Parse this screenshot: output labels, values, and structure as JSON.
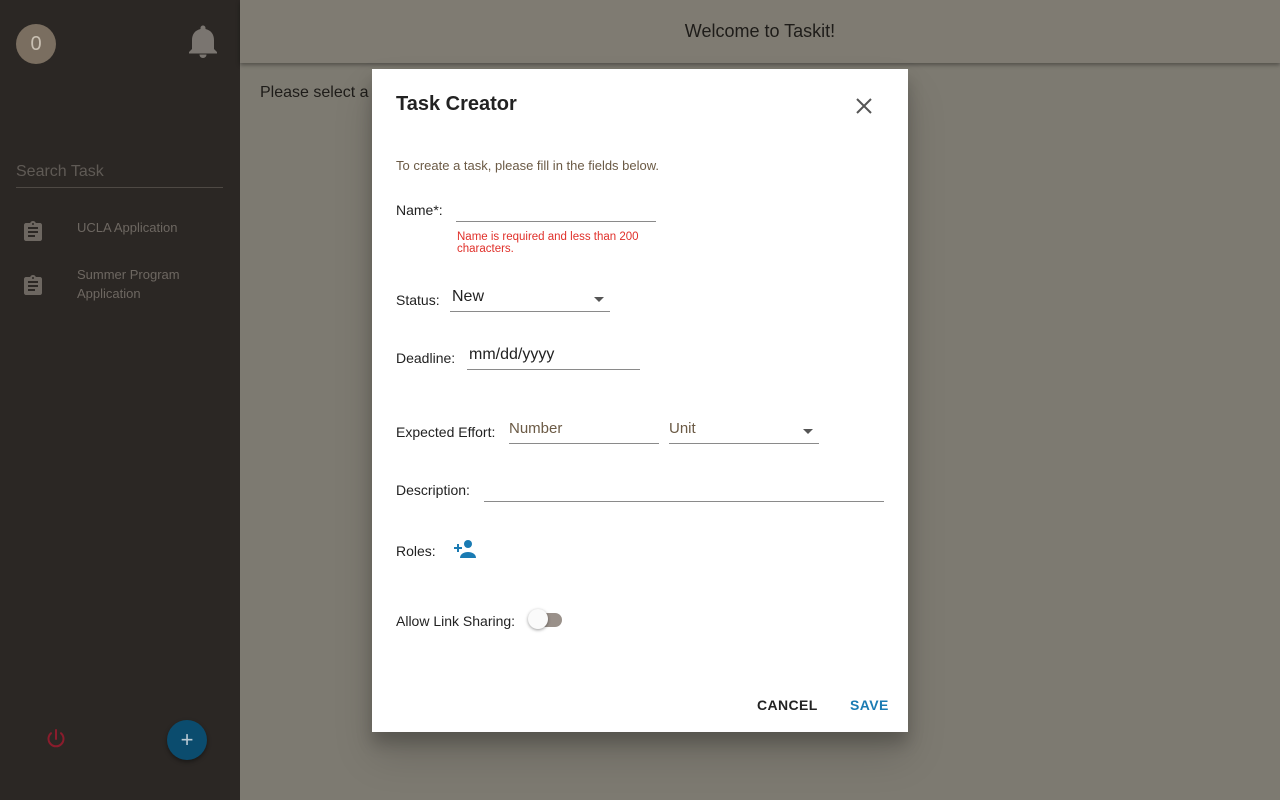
{
  "sidebar": {
    "avatar_text": "0",
    "search_placeholder": "Search Task",
    "tasks": [
      {
        "label": "UCLA Application"
      },
      {
        "label": "Summer Program Application"
      }
    ]
  },
  "header": {
    "title": "Welcome to Taskit!"
  },
  "main": {
    "message": "Please select a"
  },
  "dialog": {
    "title": "Task Creator",
    "instructions": "To create a task, please fill in the fields below.",
    "name_label": "Name*:",
    "name_value": "",
    "name_error": "Name is required and less than 200 characters.",
    "status_label": "Status:",
    "status_value": "New",
    "deadline_label": "Deadline:",
    "deadline_placeholder": "mm/dd/yyyy",
    "effort_label": "Expected Effort:",
    "effort_number_placeholder": "Number",
    "effort_unit_placeholder": "Unit",
    "description_label": "Description:",
    "description_value": "",
    "roles_label": "Roles:",
    "link_sharing_label": "Allow Link Sharing:",
    "link_sharing_enabled": false,
    "cancel_label": "CANCEL",
    "save_label": "SAVE"
  },
  "colors": {
    "accent": "#1a7bb3",
    "error": "#e0302a",
    "fab": "#0b4c6e",
    "power": "#8a1c2c"
  },
  "icons": [
    "bell-icon",
    "clipboard-icon",
    "power-icon",
    "plus-icon",
    "close-icon",
    "add-person-icon"
  ]
}
